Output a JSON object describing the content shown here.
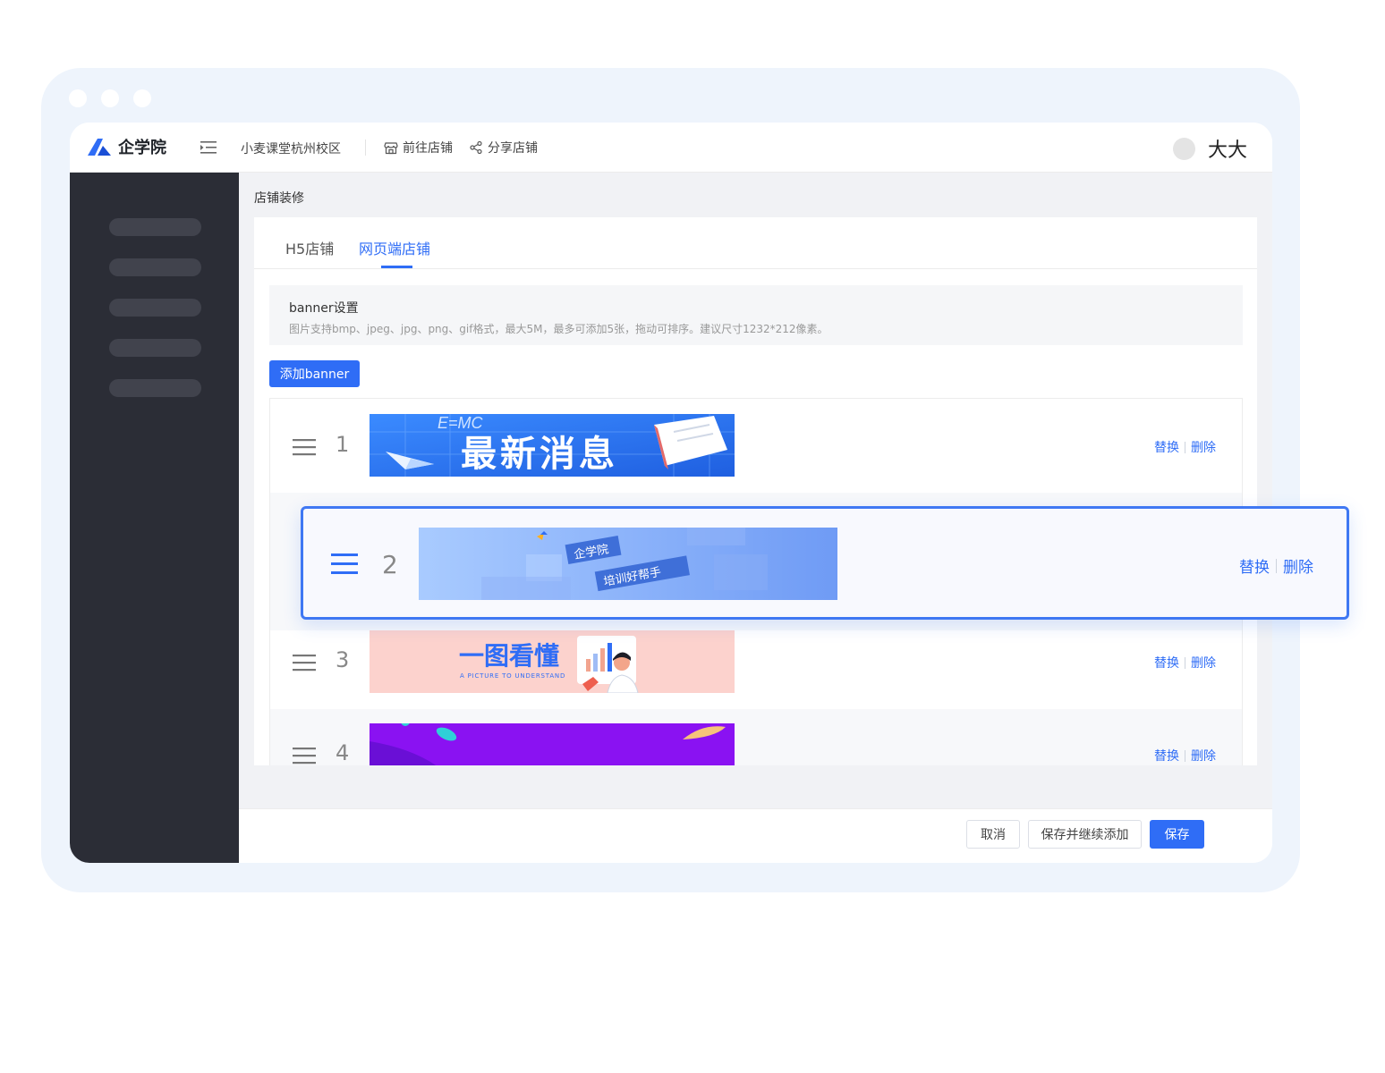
{
  "app": {
    "brand": "企学院",
    "school": "小麦课堂杭州校区",
    "links": [
      {
        "label": "前往店铺",
        "icon": "store-icon"
      },
      {
        "label": "分享店铺",
        "icon": "share-icon"
      }
    ],
    "username": "大大"
  },
  "sidebar": {
    "items": 5
  },
  "page": {
    "title": "店铺装修",
    "tabs": [
      {
        "label": "H5店铺",
        "active": false
      },
      {
        "label": "网页端店铺",
        "active": true
      }
    ]
  },
  "banner_settings": {
    "title": "banner设置",
    "description": "图片支持bmp、jpeg、jpg、png、gif格式，最大5M，最多可添加5张，拖动可排序。建议尺寸1232*212像素。",
    "add_button": "添加banner",
    "replace_label": "替换",
    "delete_label": "删除",
    "rows": [
      {
        "index": "1",
        "thumb": {
          "headline": "最新消息",
          "formula": "E=MC"
        }
      },
      {
        "index": "2",
        "thumb": {
          "line1": "企学院",
          "line2": "培训好帮手"
        },
        "dragging": true
      },
      {
        "index": "3",
        "thumb": {
          "headline": "一图看懂",
          "subline": "A PICTURE TO UNDERSTAND"
        }
      },
      {
        "index": "4",
        "thumb": {}
      }
    ]
  },
  "footer": {
    "cancel": "取消",
    "save_continue": "保存并继续添加",
    "save": "保存"
  },
  "colors": {
    "accent": "#2f6df6",
    "sidebar": "#2b2d36",
    "frame": "#eef4fc"
  }
}
